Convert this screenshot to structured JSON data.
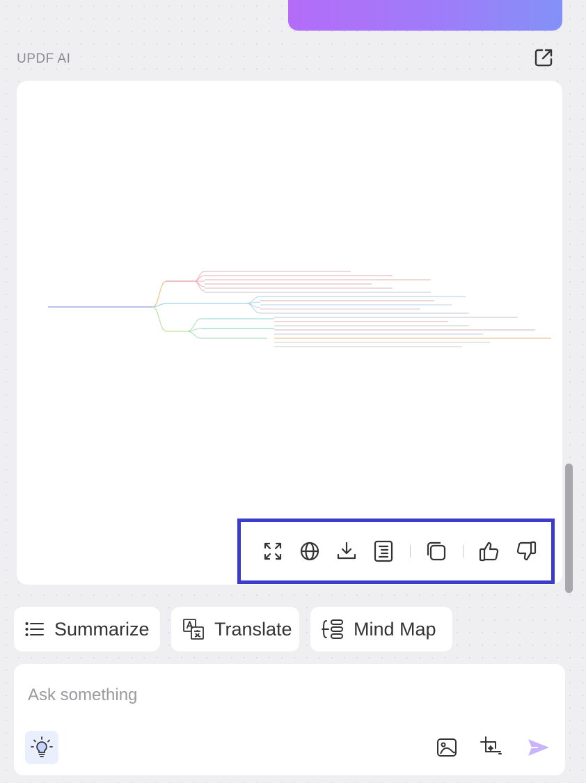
{
  "chat": {
    "assistant_label": "UPDF AI"
  },
  "quick_actions": {
    "summarize_label": "Summarize",
    "translate_label": "Translate",
    "mind_map_label": "Mind Map"
  },
  "input": {
    "placeholder": "Ask something"
  },
  "colors": {
    "user_bubble_gradient": [
      "#b46cf8",
      "#8391f8"
    ],
    "highlight_border": "#3c3ccc",
    "send_icon": "#c9b4fb",
    "bulb_bg": "#eaeffe"
  },
  "icons": {
    "export": "external-link-icon",
    "toolbar": [
      "fullscreen-icon",
      "globe-icon",
      "download-icon",
      "document-icon",
      "copy-icon",
      "thumbs-up-icon",
      "thumbs-down-icon"
    ],
    "input": [
      "lightbulb-icon",
      "image-icon",
      "screenshot-crop-icon",
      "send-icon"
    ]
  }
}
